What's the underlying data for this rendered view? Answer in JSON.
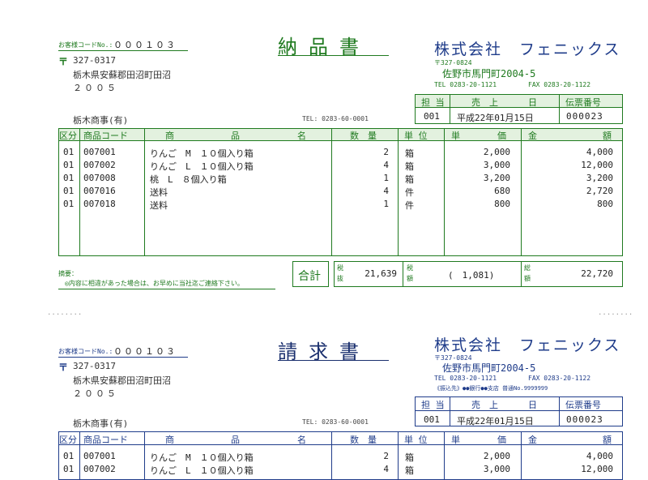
{
  "doc1": {
    "customer_code_label": "お客様コードNo.:",
    "customer_code": "０００１０３",
    "postal_mark": "〒",
    "postal_code": "327-0317",
    "address_line": "栃木県安蘇郡田沼町田沼",
    "address_number": "２００５",
    "title": "納品書",
    "company_name": "株式会社　フェニックス",
    "company_postal": "〒327-0824",
    "company_address": "佐野市馬門町2004-5",
    "company_tel": "TEL 0283-20-1121",
    "company_fax": "FAX 0283-20-1122",
    "customer_name": "栃木商事(有)",
    "customer_tel": "TEL: 0283-60-0001",
    "info_headers": [
      "担 当",
      "売　上",
      "日",
      "伝票番号"
    ],
    "staff": "001",
    "sale_date": "平成22年01月15日",
    "slip_no": "000023",
    "columns": [
      "区分",
      "商品コード",
      "商",
      "品",
      "名",
      "数　量",
      "単 位",
      "単",
      "価",
      "金",
      "額"
    ],
    "rows": [
      {
        "kind": "01",
        "code": "007001",
        "name": "りんご　M　１０個入り箱",
        "qty": "2",
        "unit": "箱",
        "price": "2,000",
        "amount": "4,000"
      },
      {
        "kind": "01",
        "code": "007002",
        "name": "りんご　L　１０個入り箱",
        "qty": "4",
        "unit": "箱",
        "price": "3,000",
        "amount": "12,000"
      },
      {
        "kind": "01",
        "code": "007008",
        "name": "桃　L　８個入り箱",
        "qty": "1",
        "unit": "箱",
        "price": "3,200",
        "amount": "3,200"
      },
      {
        "kind": "01",
        "code": "007016",
        "name": "送料",
        "qty": "4",
        "unit": "件",
        "price": "680",
        "amount": "2,720"
      },
      {
        "kind": "01",
        "code": "007018",
        "name": "送料",
        "qty": "1",
        "unit": "件",
        "price": "800",
        "amount": "800"
      }
    ],
    "memo_label": "摘要：",
    "notice": "◎内容に相違があった場合は、お早めに当社迄ご連絡下さい。",
    "total_label": "合計",
    "tax_excl_label1": "税",
    "tax_excl_label2": "抜",
    "subtotal": "21,639",
    "tax_label1": "税",
    "tax_label2": "額",
    "tax": "(　1,081)",
    "incl_label1": "総",
    "incl_label2": "額",
    "total": "22,720"
  },
  "separator_left": "........",
  "separator_right": "........",
  "doc2": {
    "customer_code_label": "お客様コードNo.:",
    "customer_code": "０００１０３",
    "postal_mark": "〒",
    "postal_code": "327-0317",
    "address_line": "栃木県安蘇郡田沼町田沼",
    "address_number": "２００５",
    "title": "請求書",
    "company_name": "株式会社　フェニックス",
    "company_postal": "〒327-0824",
    "company_address": "佐野市馬門町2004-5",
    "company_tel": "TEL 0283-20-1121",
    "company_fax": "FAX 0283-20-1122",
    "bank_info": "《振込先》●●銀行●●支店 普通No.9999999",
    "customer_name": "栃木商事(有)",
    "customer_tel": "TEL: 0283-60-0001",
    "info_headers": [
      "担 当",
      "売　上",
      "日",
      "伝票番号"
    ],
    "staff": "001",
    "sale_date": "平成22年01月15日",
    "slip_no": "000023",
    "columns": [
      "区分",
      "商品コード",
      "商",
      "品",
      "名",
      "数　量",
      "単 位",
      "単",
      "価",
      "金",
      "額"
    ],
    "rows": [
      {
        "kind": "01",
        "code": "007001",
        "name": "りんご　M　１０個入り箱",
        "qty": "2",
        "unit": "箱",
        "price": "2,000",
        "amount": "4,000"
      },
      {
        "kind": "01",
        "code": "007002",
        "name": "りんご　L　１０個入り箱",
        "qty": "4",
        "unit": "箱",
        "price": "3,000",
        "amount": "12,000"
      }
    ]
  }
}
